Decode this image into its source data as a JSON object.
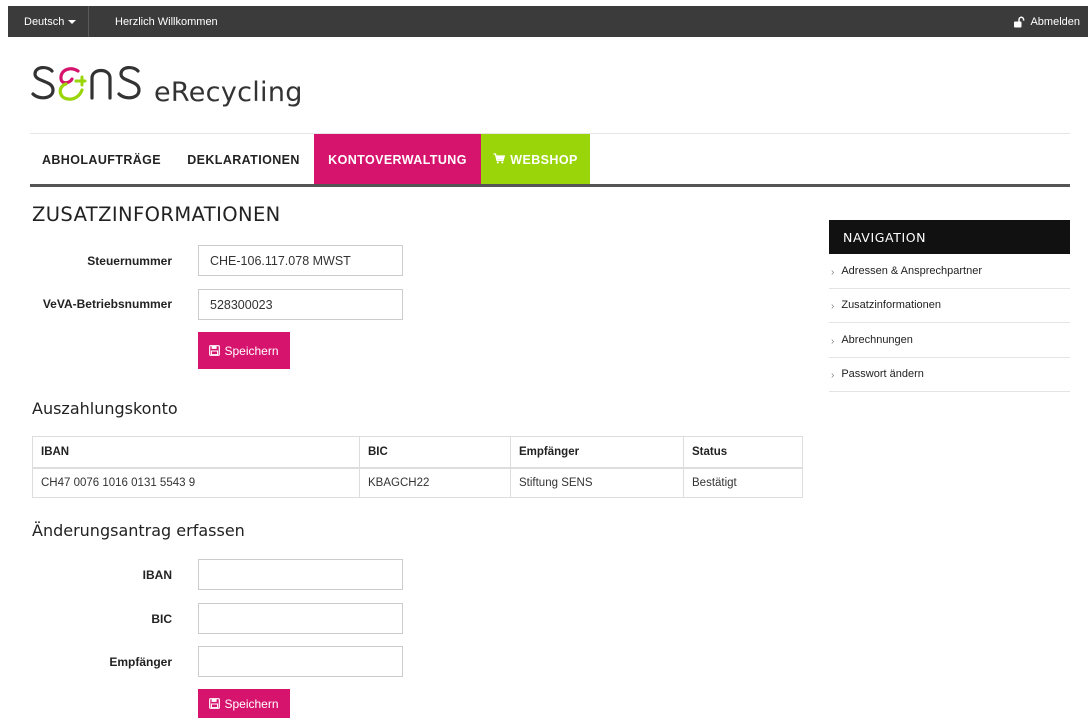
{
  "topbar": {
    "language": "Deutsch",
    "welcome": "Herzlich Willkommen",
    "logout": "Abmelden"
  },
  "logo": {
    "brand": "SENS",
    "sub": "eRecycling"
  },
  "mainnav": {
    "tabs": [
      {
        "label": "ABHOLAUFTRÄGE"
      },
      {
        "label": "DEKLARATIONEN"
      },
      {
        "label": "KONTOVERWALTUNG"
      },
      {
        "label": "WEBSHOP"
      }
    ],
    "active_color": "#d6146e",
    "webshop_color": "#9ad50a"
  },
  "zusatz": {
    "title": "ZUSATZINFORMATIONEN",
    "steuernummer_label": "Steuernummer",
    "steuernummer_value": "CHE-106.117.078 MWST",
    "veva_label": "VeVA-Betriebsnummer",
    "veva_value": "528300023",
    "save_label": "Speichern"
  },
  "auszahlung": {
    "title": "Auszahlungskonto",
    "columns": [
      "IBAN",
      "BIC",
      "Empfänger",
      "Status"
    ],
    "rows": [
      [
        "CH47 0076 1016 0131 5543 9",
        "KBAGCH22",
        "Stiftung SENS",
        "Bestätigt"
      ]
    ]
  },
  "aenderung": {
    "title": "Änderungsantrag erfassen",
    "iban_label": "IBAN",
    "iban_value": "",
    "bic_label": "BIC",
    "bic_value": "",
    "empfaenger_label": "Empfänger",
    "empfaenger_value": "",
    "save_label": "Speichern"
  },
  "sidenav": {
    "heading": "NAVIGATION",
    "items": [
      {
        "label": "Adressen & Ansprechpartner"
      },
      {
        "label": "Zusatzinformationen"
      },
      {
        "label": "Abrechnungen"
      },
      {
        "label": "Passwort ändern"
      }
    ]
  },
  "icons": {
    "cart": "cart-icon",
    "floppy": "floppy-disk-icon",
    "lock": "unlock-icon",
    "caret": "caret-down-icon"
  }
}
